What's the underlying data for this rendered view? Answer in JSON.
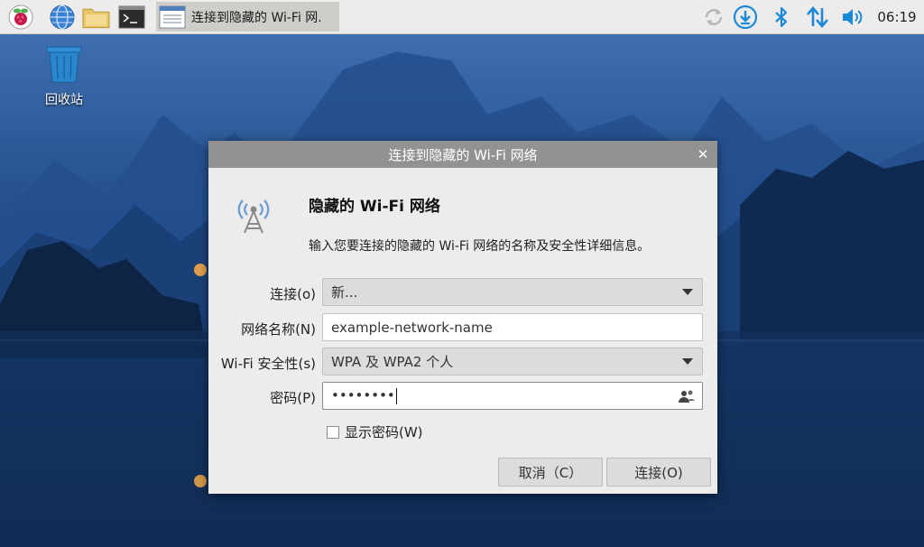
{
  "taskbar": {
    "task_title": "连接到隐藏的 Wi-Fi 网.",
    "clock": "06:19",
    "icons": [
      "raspberry-menu-icon",
      "browser-globe-icon",
      "file-manager-folder-icon",
      "terminal-icon"
    ],
    "tray_icons": [
      "network-sync-icon",
      "updates-download-icon",
      "bluetooth-icon",
      "network-arrows-icon",
      "volume-icon"
    ]
  },
  "desktop": {
    "trash_label": "回收站"
  },
  "dialog": {
    "title": "连接到隐藏的 Wi-Fi 网络",
    "heading": "隐藏的 Wi-Fi 网络",
    "description": "输入您要连接的隐藏的 Wi-Fi 网络的名称及安全性详细信息。",
    "fields": {
      "connection_label": "连接(o)",
      "connection_value": "新...",
      "network_name_label": "网络名称(N)",
      "network_name_value": "example-network-name",
      "security_label": "Wi-Fi 安全性(s)",
      "security_value": "WPA 及 WPA2 个人",
      "password_label": "密码(P)",
      "password_value": "••••••••"
    },
    "show_password_label": "显示密码(W)",
    "show_password_checked": false,
    "cancel_label": "取消（C）",
    "connect_label": "连接(O)"
  },
  "colors": {
    "taskbar_bg": "#edeceb",
    "titlebar_bg": "#929292",
    "dialog_bg": "#edeceb",
    "accent_blue": "#1b8ad6"
  }
}
